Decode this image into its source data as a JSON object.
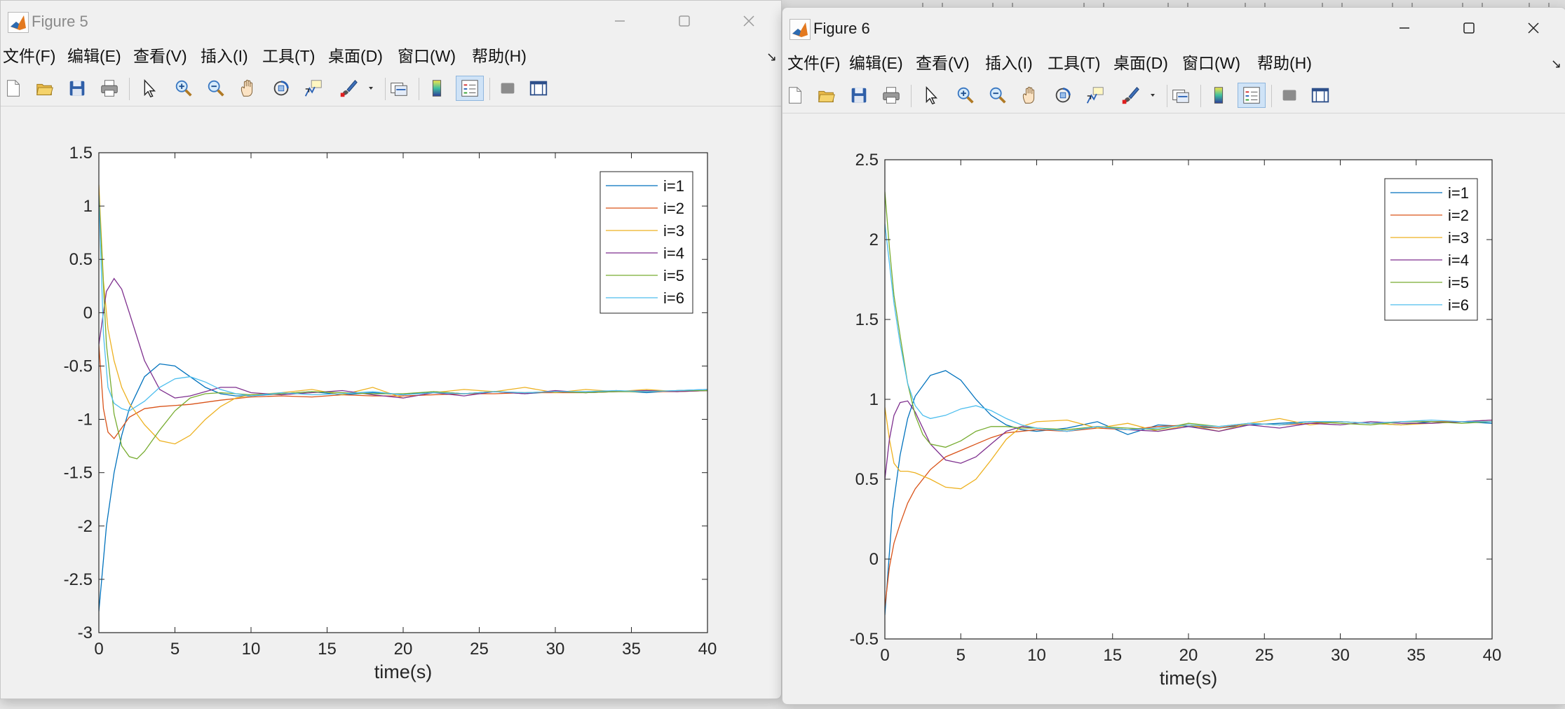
{
  "windows": [
    {
      "title": "Figure 5",
      "menu": [
        "文件(F)",
        "编辑(E)",
        "查看(V)",
        "插入(I)",
        "工具(T)",
        "桌面(D)",
        "窗口(W)",
        "帮助(H)"
      ]
    },
    {
      "title": "Figure 6",
      "menu": [
        "文件(F)",
        "编辑(E)",
        "查看(V)",
        "插入(I)",
        "工具(T)",
        "桌面(D)",
        "窗口(W)",
        "帮助(H)"
      ]
    }
  ],
  "toolbar": {
    "icons": [
      "new-figure-icon",
      "open-file-icon",
      "save-icon",
      "print-icon",
      "pointer-icon",
      "zoom-in-icon",
      "zoom-out-icon",
      "pan-hand-icon",
      "rotate-3d-icon",
      "data-cursor-icon",
      "brush-icon",
      "brush-dropdown-icon",
      "link-plot-icon",
      "colorbar-icon",
      "legend-icon",
      "hide-plot-tools-icon",
      "show-plot-tools-icon"
    ]
  },
  "series_colors": [
    "#0072BD",
    "#D95319",
    "#EDB120",
    "#7E2F8E",
    "#77AC30",
    "#4DBEEE"
  ],
  "chart_data": [
    {
      "type": "line",
      "xlabel": "time(s)",
      "ylabel": "",
      "title": "",
      "xlim": [
        0,
        40
      ],
      "ylim": [
        -3,
        1.5
      ],
      "xticks": [
        0,
        5,
        10,
        15,
        20,
        25,
        30,
        35,
        40
      ],
      "yticks": [
        -3,
        -2.5,
        -2,
        -1.5,
        -1,
        -0.5,
        0,
        0.5,
        1,
        1.5
      ],
      "legend": "top-right",
      "grid": false,
      "series": [
        {
          "name": "i=1",
          "x": [
            0,
            0.5,
            1,
            1.5,
            2,
            3,
            4,
            5,
            6,
            7,
            8,
            9,
            10,
            12,
            14,
            16,
            18,
            20,
            22,
            24,
            26,
            28,
            30,
            32,
            34,
            36,
            38,
            40
          ],
          "y": [
            -2.8,
            -2.0,
            -1.5,
            -1.15,
            -0.9,
            -0.6,
            -0.48,
            -0.5,
            -0.6,
            -0.7,
            -0.76,
            -0.78,
            -0.78,
            -0.76,
            -0.74,
            -0.77,
            -0.75,
            -0.77,
            -0.74,
            -0.76,
            -0.74,
            -0.76,
            -0.74,
            -0.75,
            -0.73,
            -0.75,
            -0.73,
            -0.72
          ]
        },
        {
          "name": "i=2",
          "x": [
            0,
            0.3,
            0.6,
            1,
            1.5,
            2,
            3,
            4,
            6,
            8,
            10,
            12,
            14,
            16,
            18,
            20,
            22,
            24,
            26,
            28,
            30,
            32,
            34,
            36,
            38,
            40
          ],
          "y": [
            -0.3,
            -0.9,
            -1.12,
            -1.18,
            -1.08,
            -0.98,
            -0.9,
            -0.88,
            -0.86,
            -0.82,
            -0.79,
            -0.78,
            -0.79,
            -0.77,
            -0.78,
            -0.78,
            -0.77,
            -0.76,
            -0.76,
            -0.75,
            -0.75,
            -0.75,
            -0.74,
            -0.74,
            -0.74,
            -0.73
          ]
        },
        {
          "name": "i=3",
          "x": [
            0,
            0.3,
            0.6,
            1,
            1.5,
            2,
            3,
            4,
            5,
            6,
            7,
            8,
            9,
            10,
            12,
            14,
            16,
            18,
            20,
            22,
            24,
            26,
            28,
            30,
            32,
            34,
            36,
            38,
            40
          ],
          "y": [
            1.2,
            0.3,
            -0.15,
            -0.45,
            -0.7,
            -0.85,
            -1.05,
            -1.2,
            -1.23,
            -1.15,
            -1.0,
            -0.88,
            -0.8,
            -0.77,
            -0.75,
            -0.72,
            -0.77,
            -0.7,
            -0.8,
            -0.75,
            -0.72,
            -0.74,
            -0.7,
            -0.75,
            -0.72,
            -0.74,
            -0.72,
            -0.74,
            -0.73
          ]
        },
        {
          "name": "i=4",
          "x": [
            0,
            0.5,
            1,
            1.5,
            2,
            3,
            4,
            5,
            6,
            7,
            8,
            9,
            10,
            12,
            14,
            16,
            18,
            20,
            22,
            24,
            26,
            28,
            30,
            32,
            34,
            36,
            38,
            40
          ],
          "y": [
            -0.3,
            0.2,
            0.32,
            0.22,
            0.0,
            -0.45,
            -0.72,
            -0.8,
            -0.78,
            -0.74,
            -0.7,
            -0.7,
            -0.75,
            -0.77,
            -0.75,
            -0.73,
            -0.77,
            -0.8,
            -0.75,
            -0.78,
            -0.74,
            -0.76,
            -0.73,
            -0.75,
            -0.74,
            -0.73,
            -0.74,
            -0.73
          ]
        },
        {
          "name": "i=5",
          "x": [
            0,
            0.5,
            1,
            1.5,
            2,
            2.5,
            3,
            4,
            5,
            6,
            7,
            8,
            9,
            10,
            12,
            14,
            16,
            18,
            20,
            22,
            24,
            26,
            28,
            30,
            32,
            34,
            36,
            38,
            40
          ],
          "y": [
            1.1,
            -0.3,
            -0.95,
            -1.25,
            -1.35,
            -1.37,
            -1.3,
            -1.1,
            -0.92,
            -0.8,
            -0.76,
            -0.75,
            -0.76,
            -0.77,
            -0.76,
            -0.74,
            -0.75,
            -0.76,
            -0.76,
            -0.74,
            -0.76,
            -0.74,
            -0.75,
            -0.74,
            -0.75,
            -0.74,
            -0.74,
            -0.73,
            -0.73
          ]
        },
        {
          "name": "i=6",
          "x": [
            0,
            0.3,
            0.6,
            1,
            1.5,
            2,
            3,
            4,
            5,
            6,
            7,
            8,
            9,
            10,
            12,
            14,
            16,
            18,
            20,
            22,
            24,
            26,
            28,
            30,
            32,
            34,
            36,
            38,
            40
          ],
          "y": [
            1.1,
            -0.2,
            -0.7,
            -0.85,
            -0.9,
            -0.92,
            -0.83,
            -0.7,
            -0.62,
            -0.6,
            -0.65,
            -0.72,
            -0.76,
            -0.78,
            -0.75,
            -0.77,
            -0.76,
            -0.74,
            -0.77,
            -0.75,
            -0.76,
            -0.74,
            -0.75,
            -0.74,
            -0.74,
            -0.73,
            -0.74,
            -0.73,
            -0.72
          ]
        }
      ]
    },
    {
      "type": "line",
      "xlabel": "time(s)",
      "ylabel": "",
      "title": "",
      "xlim": [
        0,
        40
      ],
      "ylim": [
        -0.5,
        2.5
      ],
      "xticks": [
        0,
        5,
        10,
        15,
        20,
        25,
        30,
        35,
        40
      ],
      "yticks": [
        -0.5,
        0,
        0.5,
        1,
        1.5,
        2,
        2.5
      ],
      "legend": "top-right",
      "grid": false,
      "series": [
        {
          "name": "i=1",
          "x": [
            0,
            0.5,
            1,
            1.5,
            2,
            3,
            4,
            5,
            6,
            7,
            8,
            9,
            10,
            12,
            14,
            16,
            18,
            20,
            22,
            24,
            26,
            28,
            30,
            32,
            34,
            36,
            38,
            40
          ],
          "y": [
            -0.35,
            0.3,
            0.65,
            0.88,
            1.02,
            1.15,
            1.18,
            1.12,
            1.0,
            0.9,
            0.84,
            0.81,
            0.8,
            0.82,
            0.86,
            0.78,
            0.84,
            0.83,
            0.82,
            0.84,
            0.85,
            0.86,
            0.86,
            0.85,
            0.84,
            0.86,
            0.86,
            0.85
          ]
        },
        {
          "name": "i=2",
          "x": [
            0,
            0.3,
            0.6,
            1,
            1.5,
            2,
            3,
            4,
            5,
            6,
            7,
            8,
            10,
            12,
            14,
            16,
            18,
            20,
            22,
            24,
            26,
            28,
            30,
            32,
            34,
            36,
            38,
            40
          ],
          "y": [
            -0.3,
            -0.05,
            0.1,
            0.22,
            0.35,
            0.44,
            0.56,
            0.64,
            0.68,
            0.72,
            0.76,
            0.79,
            0.81,
            0.8,
            0.82,
            0.81,
            0.83,
            0.84,
            0.82,
            0.85,
            0.84,
            0.85,
            0.86,
            0.85,
            0.86,
            0.86,
            0.86,
            0.87
          ]
        },
        {
          "name": "i=3",
          "x": [
            0,
            0.3,
            0.6,
            1,
            1.5,
            2,
            3,
            4,
            5,
            6,
            7,
            8,
            9,
            10,
            12,
            14,
            16,
            18,
            20,
            22,
            24,
            26,
            28,
            30,
            32,
            34,
            36,
            38,
            40
          ],
          "y": [
            0.95,
            0.75,
            0.6,
            0.55,
            0.55,
            0.54,
            0.5,
            0.45,
            0.44,
            0.5,
            0.62,
            0.75,
            0.83,
            0.86,
            0.87,
            0.82,
            0.85,
            0.8,
            0.84,
            0.8,
            0.85,
            0.88,
            0.84,
            0.86,
            0.85,
            0.84,
            0.85,
            0.86,
            0.86
          ]
        },
        {
          "name": "i=4",
          "x": [
            0,
            0.3,
            0.6,
            1,
            1.5,
            2,
            3,
            4,
            5,
            6,
            7,
            8,
            9,
            10,
            12,
            14,
            16,
            18,
            20,
            22,
            24,
            26,
            28,
            30,
            32,
            34,
            36,
            38,
            40
          ],
          "y": [
            0.5,
            0.75,
            0.9,
            0.98,
            0.99,
            0.92,
            0.72,
            0.62,
            0.6,
            0.64,
            0.72,
            0.8,
            0.83,
            0.82,
            0.8,
            0.83,
            0.81,
            0.8,
            0.83,
            0.8,
            0.84,
            0.82,
            0.85,
            0.84,
            0.86,
            0.85,
            0.85,
            0.86,
            0.87
          ]
        },
        {
          "name": "i=5",
          "x": [
            0,
            0.3,
            0.6,
            1,
            1.5,
            2,
            2.5,
            3,
            4,
            5,
            6,
            7,
            8,
            9,
            10,
            12,
            14,
            16,
            18,
            20,
            22,
            24,
            26,
            28,
            30,
            32,
            34,
            36,
            38,
            40
          ],
          "y": [
            2.3,
            1.95,
            1.65,
            1.4,
            1.1,
            0.9,
            0.78,
            0.72,
            0.7,
            0.74,
            0.8,
            0.83,
            0.83,
            0.82,
            0.82,
            0.81,
            0.83,
            0.82,
            0.81,
            0.85,
            0.83,
            0.85,
            0.84,
            0.86,
            0.85,
            0.84,
            0.86,
            0.86,
            0.85,
            0.86
          ]
        },
        {
          "name": "i=6",
          "x": [
            0,
            0.3,
            0.6,
            1,
            1.5,
            2,
            2.5,
            3,
            4,
            5,
            6,
            7,
            8,
            9,
            10,
            12,
            14,
            16,
            18,
            20,
            22,
            24,
            26,
            28,
            30,
            32,
            34,
            36,
            38,
            40
          ],
          "y": [
            2.1,
            1.85,
            1.6,
            1.35,
            1.1,
            0.96,
            0.9,
            0.88,
            0.9,
            0.94,
            0.96,
            0.93,
            0.88,
            0.84,
            0.82,
            0.8,
            0.83,
            0.81,
            0.82,
            0.84,
            0.83,
            0.85,
            0.84,
            0.86,
            0.86,
            0.85,
            0.86,
            0.87,
            0.86,
            0.86
          ]
        }
      ]
    }
  ]
}
